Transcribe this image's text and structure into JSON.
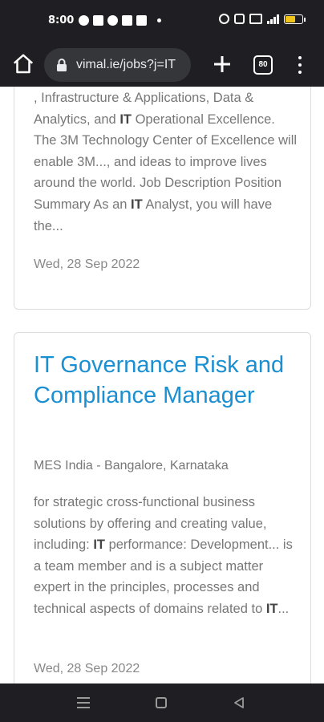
{
  "status_bar": {
    "time": "8:00",
    "battery_level": 0.6
  },
  "browser": {
    "url": "vimal.ie/jobs?j=IT",
    "tab_count": "80",
    "icons": {
      "home": "home-icon",
      "lock": "lock-icon",
      "new_tab": "plus-icon",
      "tabs": "tab-switcher-icon",
      "menu": "more-vert-icon"
    }
  },
  "results": [
    {
      "snippet_parts": [
        ", Infrastructure & Applications, Data & Analytics, and ",
        "IT",
        " Operational Excellence. The 3M Technology Center of Excellence will enable 3M..., and ideas to improve lives around the world.   Job Description   Position Summary   As an ",
        "IT",
        " Analyst, you will have the..."
      ],
      "date": "Wed, 28 Sep 2022"
    },
    {
      "title": "IT Governance Risk and Compliance Manager",
      "company": "MES India - Bangalore, Karnataka",
      "snippet_parts": [
        " for strategic cross-functional business solutions by offering and creating value, including: ",
        "IT",
        " performance: Development... is a team member and is a subject matter expert in the principles, processes and technical aspects of domains related to ",
        "IT",
        "..."
      ],
      "date": "Wed, 28 Sep 2022"
    }
  ],
  "colors": {
    "title_link": "#1a8fd1",
    "chrome_bg": "#1f1f23",
    "url_pill_bg": "#35363a",
    "battery": "#f0c419"
  },
  "nav_bar": {
    "icons": [
      "recents-icon",
      "home-circle-icon",
      "back-icon"
    ]
  }
}
